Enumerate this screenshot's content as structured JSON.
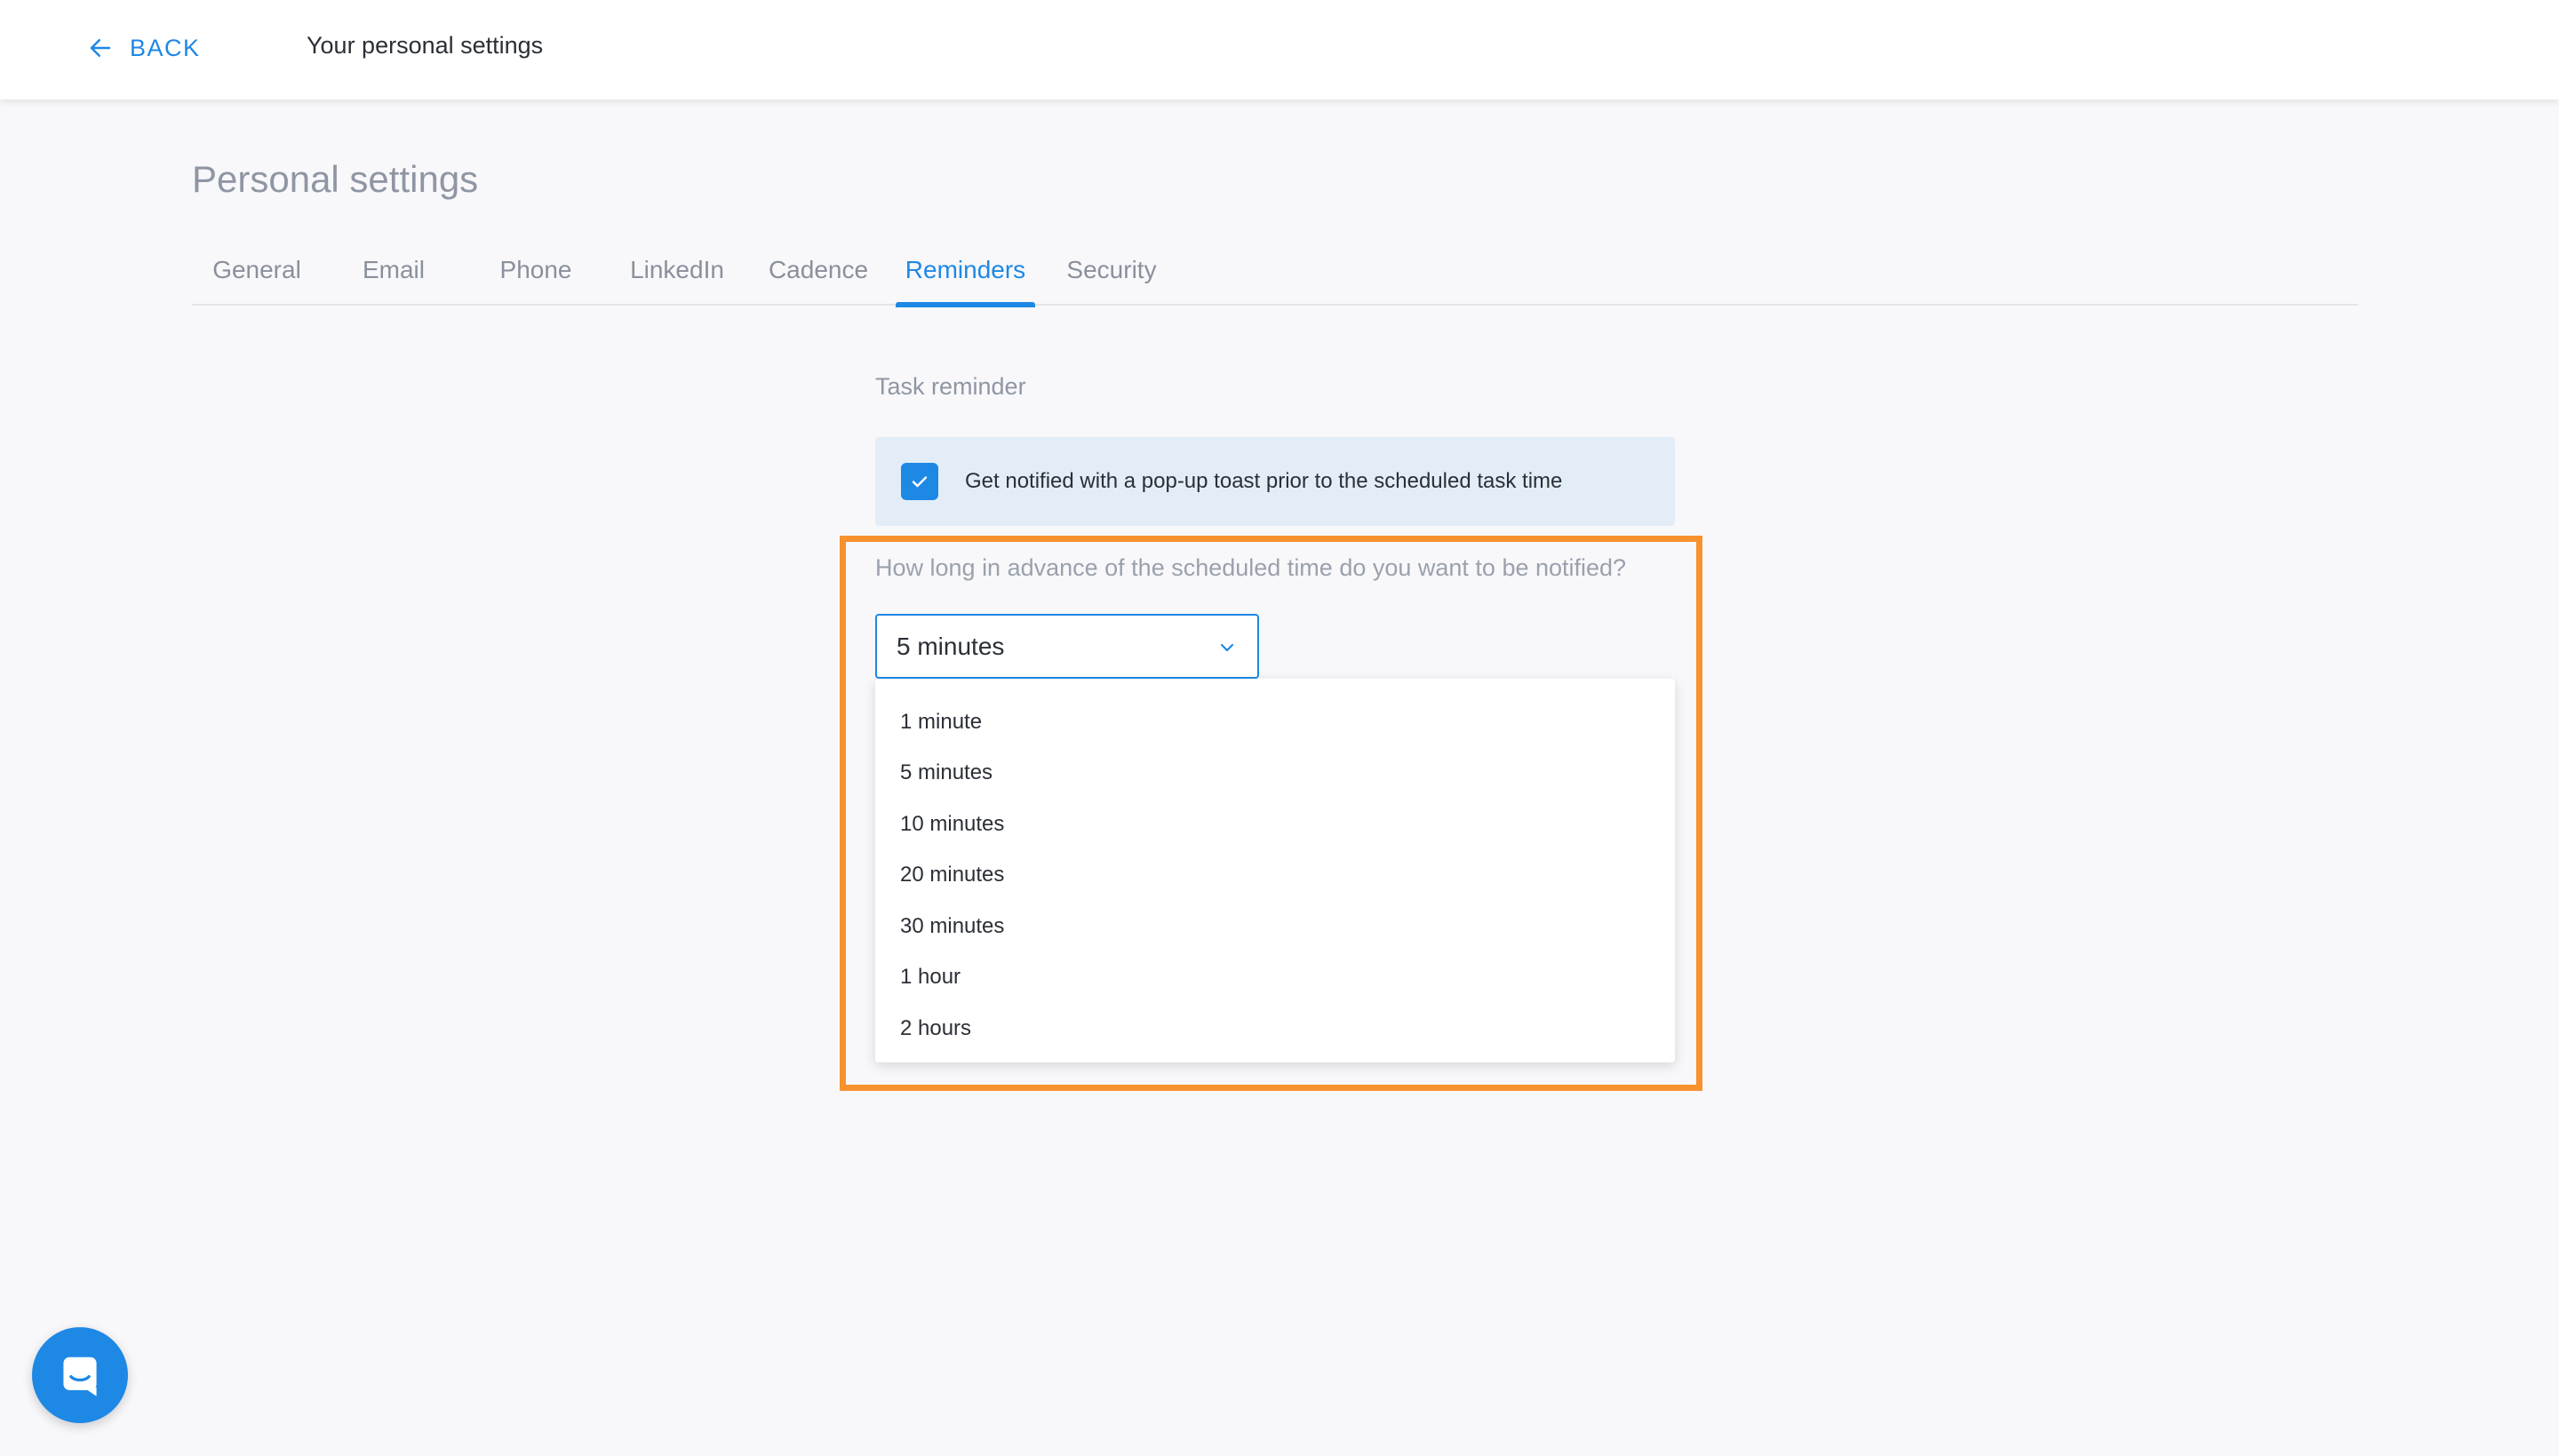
{
  "topbar": {
    "back_label": "BACK",
    "title": "Your personal settings"
  },
  "page": {
    "title": "Personal settings"
  },
  "tabs": [
    {
      "label": "General",
      "active": false
    },
    {
      "label": "Email",
      "active": false
    },
    {
      "label": "Phone",
      "active": false
    },
    {
      "label": "LinkedIn",
      "active": false
    },
    {
      "label": "Cadence",
      "active": false
    },
    {
      "label": "Reminders",
      "active": true
    },
    {
      "label": "Security",
      "active": false
    }
  ],
  "reminders": {
    "section_label": "Task reminder",
    "checkbox_label": "Get notified with a pop-up toast prior to the scheduled task time",
    "checkbox_checked": true,
    "question": "How long in advance of the scheduled time do you want to be notified?",
    "selected_value": "5 minutes",
    "options": [
      "1 minute",
      "5 minutes",
      "10 minutes",
      "20 minutes",
      "30 minutes",
      "1 hour",
      "2 hours"
    ]
  },
  "colors": {
    "accent": "#1e88e5",
    "highlight": "#f7922f",
    "checkbox_row_bg": "#e3edf8"
  },
  "icons": {
    "back": "arrow-left-icon",
    "checkbox": "checkmark-icon",
    "select": "chevron-down-icon",
    "chat": "chat-icon"
  }
}
